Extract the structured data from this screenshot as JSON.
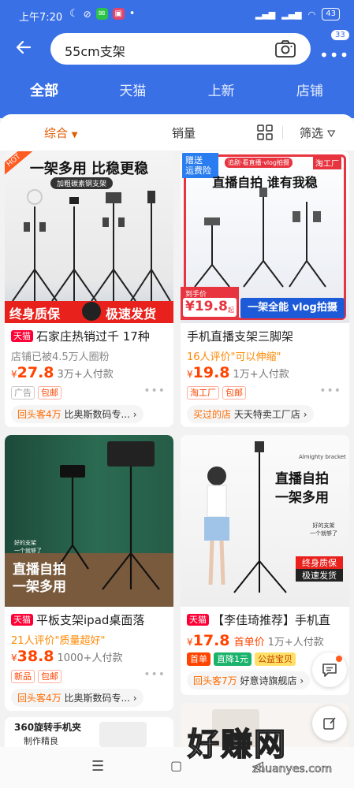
{
  "status_bar": {
    "time": "上午7:20",
    "battery": "43"
  },
  "search": {
    "query": "55cm支架",
    "more_badge": "33"
  },
  "tabs": [
    {
      "label": "全部",
      "active": true
    },
    {
      "label": "天猫"
    },
    {
      "label": "上新"
    },
    {
      "label": "店铺"
    }
  ],
  "sort": {
    "comprehensive": "综合",
    "sales": "销量",
    "filter": "筛选"
  },
  "products": [
    {
      "image_text_top": "一架多用 比稳更稳",
      "image_text_mid": "加粗碳素钢支架",
      "image_text_bottom_left": "终身质保",
      "image_text_bottom_right": "极速发货",
      "image_corner": "HOT",
      "badge": "天猫",
      "title": "石家庄热销过千 17种",
      "subtitle": "店铺已被4.5万人圈粉",
      "currency": "¥",
      "price": "27.8",
      "sales": "3万+人付款",
      "tags": [
        "广告",
        "包邮"
      ],
      "shop_prefix": "回头客4万",
      "shop_name": "比奥斯数码专..."
    },
    {
      "image_text_top": "直播自拍 谁有我稳",
      "image_label_gift": "赠送\n运费险",
      "image_label_brand": "淘工厂",
      "image_label_chips": "追剧·看直播·vlog拍摄",
      "image_price_label": "到手价",
      "image_price": "¥19.8",
      "image_price_suffix": "起",
      "image_text_bottom": "一架全能 vlog拍摄",
      "badge": "",
      "title": "手机直播支架三脚架",
      "subtitle": "16人评价\"可以伸缩\"",
      "currency": "¥",
      "price": "19.8",
      "sales": "1万+人付款",
      "tags": [
        "淘工厂",
        "包邮"
      ],
      "shop_prefix": "买过的店",
      "shop_name": "天天特卖工厂店"
    },
    {
      "image_text_bottom": "直播自拍\n一架多用",
      "image_text_small": "好的支架\n一个就够了",
      "badge": "天猫",
      "title": "平板支架ipad桌面落",
      "subtitle": "21人评价\"质量超好\"",
      "currency": "¥",
      "price": "38.8",
      "sales": "1000+人付款",
      "tags": [
        "新品",
        "包邮"
      ],
      "shop_prefix": "回头客4万",
      "shop_name": "比奥斯数码专..."
    },
    {
      "image_text_corner": "Almighty bracket",
      "image_text_main": "直播自拍\n一架多用",
      "image_text_small": "好的支架\n一个就够了",
      "image_text_red": "终身质保",
      "image_text_black": "极速发货",
      "badge": "天猫",
      "title": "【李佳琦推荐】手机直",
      "price_prefix": "",
      "currency": "¥",
      "price": "17.8",
      "price_label": "首单价",
      "sales": "1万+人付款",
      "tags": [
        "首单",
        "直降1元",
        "公益宝贝"
      ],
      "shop_prefix": "回头客7万",
      "shop_name": "好意诗旗舰店"
    }
  ],
  "partial_card": {
    "text": "360旋转手机夹",
    "subtext": "制作精良"
  },
  "watermark": {
    "text": "好赚网",
    "url": "zhuanyes.com"
  },
  "colors": {
    "brand_blue": "#3a70e6",
    "price_orange": "#ff4400",
    "tmall_red": "#ff0036"
  }
}
